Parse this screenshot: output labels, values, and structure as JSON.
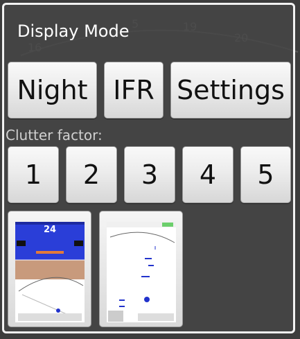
{
  "dialog": {
    "title": "Display Mode",
    "mode_buttons": [
      "Night",
      "IFR",
      "Settings"
    ],
    "clutter_label": "Clutter factor:",
    "clutter_buttons": [
      "1",
      "2",
      "3",
      "4",
      "5"
    ],
    "layouts": [
      {
        "name": "layout-thumb-efis",
        "speed": "24"
      },
      {
        "name": "layout-thumb-map"
      }
    ]
  },
  "background": {
    "compass_numbers": [
      "5",
      "19",
      "16",
      "20"
    ]
  },
  "colors": {
    "dialog_border": "#f2f2f2",
    "dialog_bg": "#464646",
    "button_face": "#ececec",
    "sky": "#2a3ed8",
    "ground": "#c89a7c"
  }
}
